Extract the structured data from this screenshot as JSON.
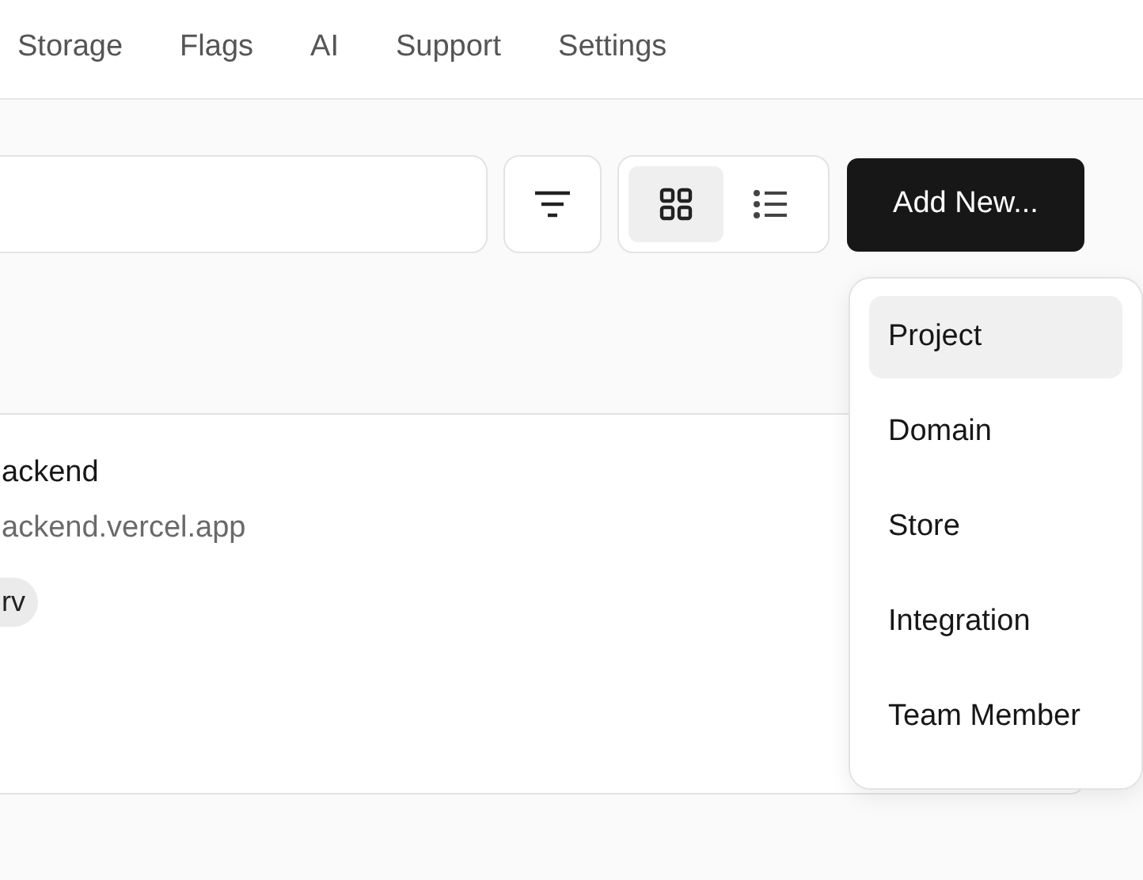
{
  "nav": {
    "tabs": [
      {
        "label": "Storage",
        "selected": false
      },
      {
        "label": "Flags",
        "selected": false
      },
      {
        "label": "AI",
        "selected": false
      },
      {
        "label": "Support",
        "selected": false
      },
      {
        "label": "Settings",
        "selected": false
      }
    ]
  },
  "toolbar": {
    "views": [
      {
        "kind": "grid",
        "selected": true
      },
      {
        "kind": "list",
        "selected": false
      }
    ],
    "add_button": "Add New..."
  },
  "project": {
    "name": "ackend",
    "url": "ackend.vercel.app",
    "tag": "rv"
  },
  "menu": {
    "items": [
      {
        "label": "Project",
        "selected": true
      },
      {
        "label": "Domain",
        "selected": false
      },
      {
        "label": "Store",
        "selected": false
      },
      {
        "label": "Integration",
        "selected": false
      },
      {
        "label": "Team Member",
        "selected": false
      }
    ]
  }
}
